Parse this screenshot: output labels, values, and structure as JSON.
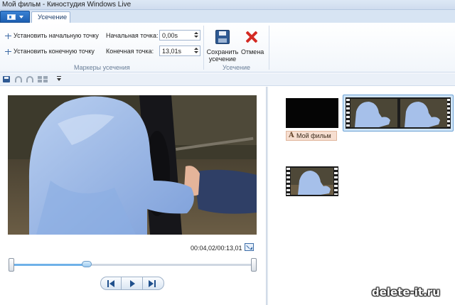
{
  "window": {
    "title": "Мой фильм - Киностудия Windows Live"
  },
  "ribbon": {
    "tabs": [
      {
        "label": "Усечение"
      }
    ],
    "trim_markers": {
      "set_start_label": "Установить начальную точку",
      "set_end_label": "Установить конечную точку",
      "start_point_label": "Начальная точка:",
      "start_point_value": "0,00s",
      "end_point_label": "Конечная точка:",
      "end_point_value": "13,01s",
      "group_label": "Маркеры усечения"
    },
    "trim": {
      "save_label_line1": "Сохранить",
      "save_label_line2": "усечение",
      "cancel_label": "Отмена",
      "group_label": "Усечение"
    }
  },
  "quick_access": {
    "icons": [
      "save-icon",
      "undo-icon",
      "redo-icon",
      "grid-icon",
      "customize-icon"
    ]
  },
  "preview": {
    "timecode": "00:04,02/00:13,01",
    "playhead_fraction": 0.31,
    "trim_start_fraction": 0.0,
    "trim_end_fraction": 1.0,
    "controls": [
      "previous-frame",
      "play",
      "next-frame"
    ]
  },
  "storyboard": {
    "caption_label": "Мой фильм"
  },
  "watermark": "delete-it.ru",
  "colors": {
    "accent": "#1d5fb1",
    "trim_fill": "#6fb1e8",
    "selection": "#cfe4f7",
    "cancel_red": "#d42a23"
  }
}
